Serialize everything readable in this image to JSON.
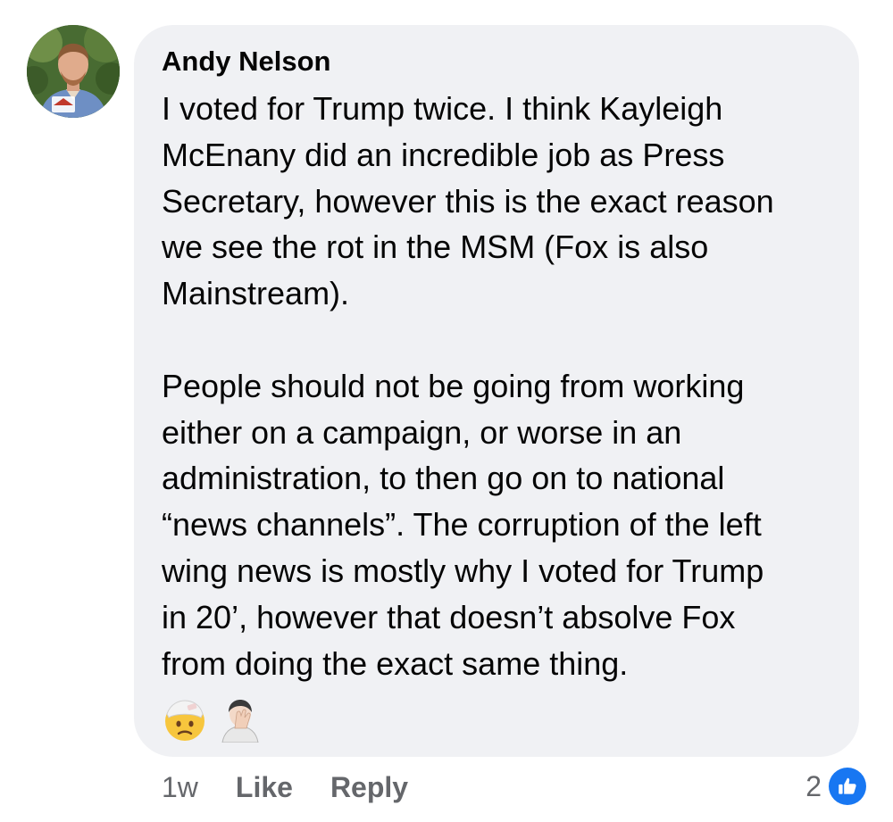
{
  "comment": {
    "author": "Andy Nelson",
    "paragraphs": [
      [
        "I voted for Trump twice. I think Kayleigh",
        "McEnany did an incredible job as Press",
        "Secretary, however this is the exact reason",
        "we see the rot in the MSM (Fox is also",
        "Mainstream)."
      ],
      [
        "People should not be going from working",
        "either on a campaign, or worse in an",
        "administration, to then go on to national",
        "“news channels”. The corruption of the left",
        "wing news is mostly why I voted for Trump",
        "in 20’, however that doesn’t absolve Fox",
        "from doing the exact same thing."
      ]
    ],
    "emojis": [
      "face-with-head-bandage-icon",
      "person-facepalming-icon"
    ],
    "timestamp": "1w",
    "like_label": "Like",
    "reply_label": "Reply",
    "reaction_count": "2",
    "reaction_icon": "like-thumbs-up-icon"
  },
  "colors": {
    "bubble": "#f0f1f4",
    "text": "#050505",
    "secondary_text": "#65676b",
    "like_blue": "#1877f2"
  }
}
